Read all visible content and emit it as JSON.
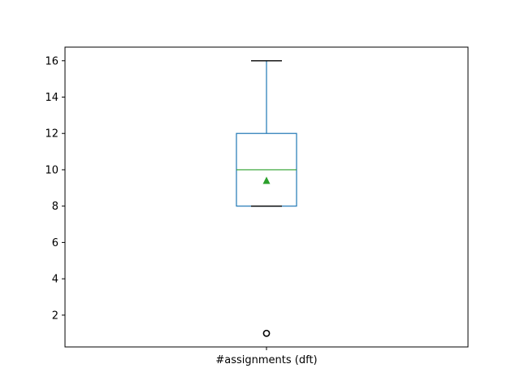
{
  "chart_data": {
    "type": "box",
    "categories": [
      "#assignments (dft)"
    ],
    "boxes": [
      {
        "label": "#assignments (dft)",
        "whisker_low": 8,
        "q1": 8,
        "median": 10,
        "q3": 12,
        "whisker_high": 16,
        "mean": 9.4,
        "outliers": [
          1
        ]
      }
    ],
    "yticks": [
      2,
      4,
      6,
      8,
      10,
      12,
      14,
      16
    ],
    "ylim": [
      0.25,
      16.75
    ],
    "grid": false,
    "colors": {
      "box": "#1f77b4",
      "median": "#2ca02c",
      "mean_marker": "#2ca02c",
      "caps": "#000000",
      "outlier": "#000000",
      "axes": "#000000"
    }
  }
}
